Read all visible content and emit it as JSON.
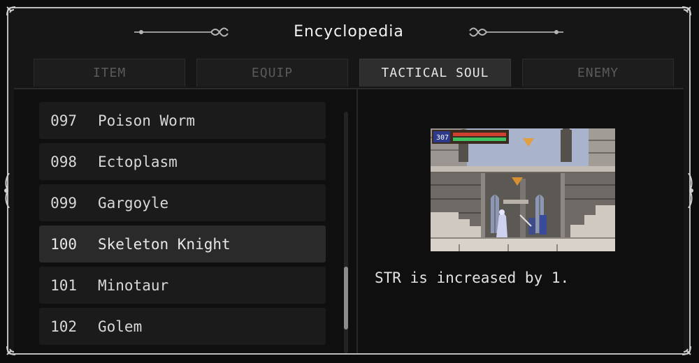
{
  "window": {
    "title": "Encyclopedia"
  },
  "tabs": [
    {
      "label": "ITEM",
      "active": false
    },
    {
      "label": "EQUIP",
      "active": false
    },
    {
      "label": "TACTICAL SOUL",
      "active": true
    },
    {
      "label": "ENEMY",
      "active": false
    }
  ],
  "list": {
    "items": [
      {
        "number": "097",
        "name": "Poison Worm"
      },
      {
        "number": "098",
        "name": "Ectoplasm"
      },
      {
        "number": "099",
        "name": "Gargoyle"
      },
      {
        "number": "100",
        "name": "Skeleton Knight",
        "selected": true
      },
      {
        "number": "101",
        "name": "Minotaur"
      },
      {
        "number": "102",
        "name": "Golem"
      }
    ],
    "scroll_position": 0.85
  },
  "detail": {
    "hud_hp": "307",
    "description": "STR is increased by 1."
  },
  "colors": {
    "frame": "#bdbdbd",
    "active_tab": "#2e2e2e",
    "row": "#1b1b1b",
    "row_selected": "#2a2a2a",
    "text": "#e2e2e2",
    "sky": "#a9b4cc",
    "stone": "#8a8580"
  }
}
